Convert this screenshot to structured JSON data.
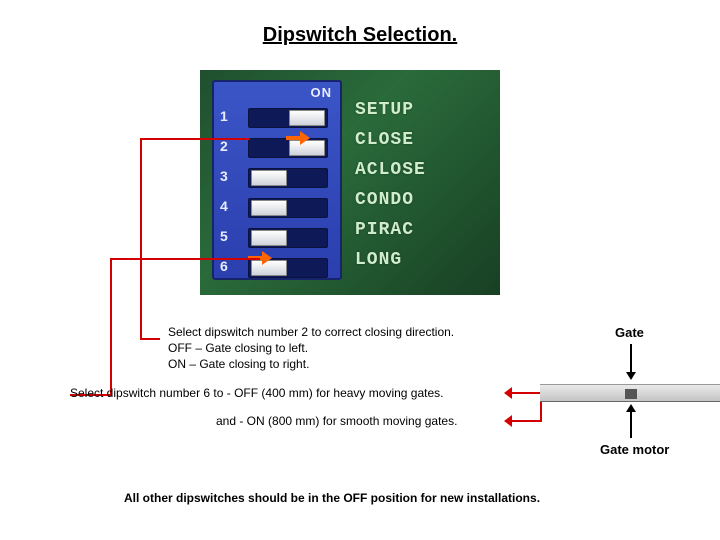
{
  "heading": "Dipswitch Selection.",
  "dip": {
    "on_label": "ON",
    "numbers": [
      "1",
      "2",
      "3",
      "4",
      "5",
      "6"
    ],
    "states": [
      "ON",
      "ON",
      "OFF",
      "OFF",
      "OFF",
      "OFF"
    ]
  },
  "pcb_labels": [
    "SETUP",
    "CLOSE",
    "ACLOSE",
    "CONDO",
    "PIRAC",
    "LONG"
  ],
  "desc_switch2": {
    "line1": "Select dipswitch number 2 to correct closing direction.",
    "line2": "OFF – Gate closing to left.",
    "line3": "ON   – Gate closing to right."
  },
  "desc_switch6": {
    "line1": "Select dipswitch number 6 to - OFF (400 mm) for heavy moving gates.",
    "line2": "and - ON (800 mm) for smooth moving gates."
  },
  "gate_label": "Gate",
  "gate_motor_label": "Gate motor",
  "footer_note": "All other dipswitches should be in the OFF position for new installations."
}
